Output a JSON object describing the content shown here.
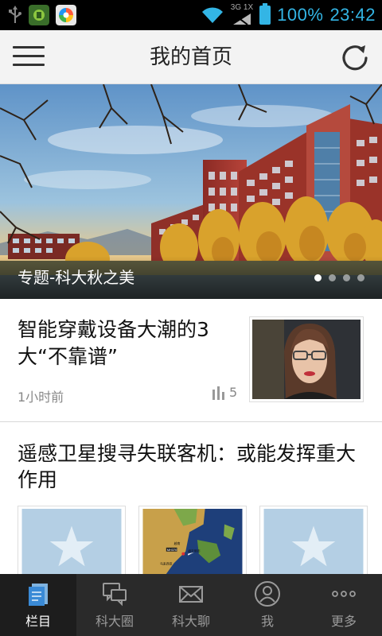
{
  "status_bar": {
    "network": "3G 1X",
    "battery": "100%",
    "time": "23:42",
    "accent_color": "#33b5e5"
  },
  "header": {
    "title": "我的首页",
    "menu_icon": "hamburger-menu-icon",
    "refresh_icon": "refresh-icon"
  },
  "banner": {
    "title": "专题-科大秋之美",
    "slide_count": 4,
    "active_slide": 1
  },
  "articles": [
    {
      "title": "智能穿戴设备大潮的3大“不靠谱”",
      "time": "1小时前",
      "views": "5",
      "stat_icon": "bar-chart-icon"
    },
    {
      "title": "遥感卫星搜寻失联客机：或能发挥重大作用",
      "map_labels": [
        "MH370",
        "越南",
        "胡志明市",
        "马来西亚"
      ]
    }
  ],
  "bottom_nav": {
    "items": [
      {
        "label": "栏目",
        "icon": "columns-icon",
        "active": true
      },
      {
        "label": "科大圈",
        "icon": "chat-bubbles-icon",
        "active": false
      },
      {
        "label": "科大聊",
        "icon": "envelope-icon",
        "active": false
      },
      {
        "label": "我",
        "icon": "user-icon",
        "active": false
      },
      {
        "label": "更多",
        "icon": "more-dots-icon",
        "active": false
      }
    ]
  }
}
